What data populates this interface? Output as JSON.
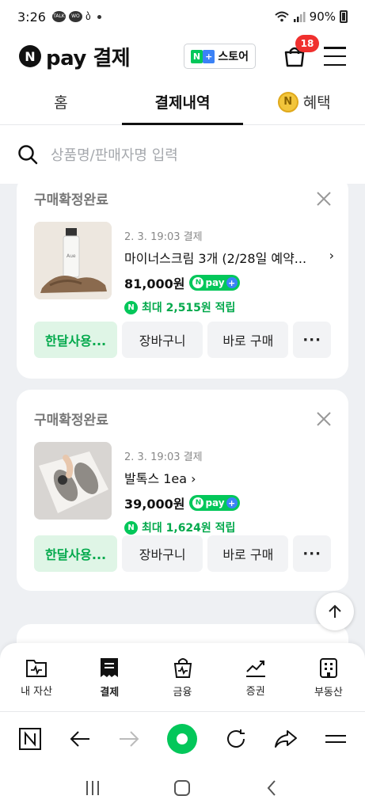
{
  "status_bar": {
    "time": "3:26",
    "battery": "90%"
  },
  "header": {
    "logo_letter": "N",
    "logo_text": "pay 결제",
    "store_label": "스토어",
    "cart_count": "18"
  },
  "tabs": [
    {
      "label": "홈"
    },
    {
      "label": "결제내역"
    },
    {
      "label": "혜택"
    }
  ],
  "search": {
    "placeholder": "상품명/판매자명 입력"
  },
  "orders": [
    {
      "status": "구매확정완료",
      "date": "2. 3. 19:03 결제",
      "name": "마이너스크림 3개 (2/28일 예약...",
      "price": "81,000원",
      "point": "최대 2,515원 적립",
      "thumb_label": "Aue",
      "buttons": {
        "monthly": "한달사용...",
        "cart": "장바구니",
        "buy": "바로 구매",
        "more": "···"
      }
    },
    {
      "status": "구매확정완료",
      "date": "2. 3. 19:03 결제",
      "name": "발톡스 1ea",
      "price": "39,000원",
      "point": "최대 1,624원 적립",
      "buttons": {
        "monthly": "한달사용...",
        "cart": "장바구니",
        "buy": "바로 구매",
        "more": "···"
      }
    }
  ],
  "npay_badge": {
    "n": "N",
    "text": "pay",
    "plus": "+"
  },
  "bottom_nav": [
    {
      "label": "내 자산",
      "icon": "wallet-icon"
    },
    {
      "label": "결제",
      "icon": "receipt-icon"
    },
    {
      "label": "금융",
      "icon": "bag-icon"
    },
    {
      "label": "증권",
      "icon": "chart-icon"
    },
    {
      "label": "부동산",
      "icon": "building-icon"
    }
  ],
  "colors": {
    "naver_green": "#03c75a",
    "badge_red": "#f0302e",
    "plus_blue": "#3b82f6"
  }
}
